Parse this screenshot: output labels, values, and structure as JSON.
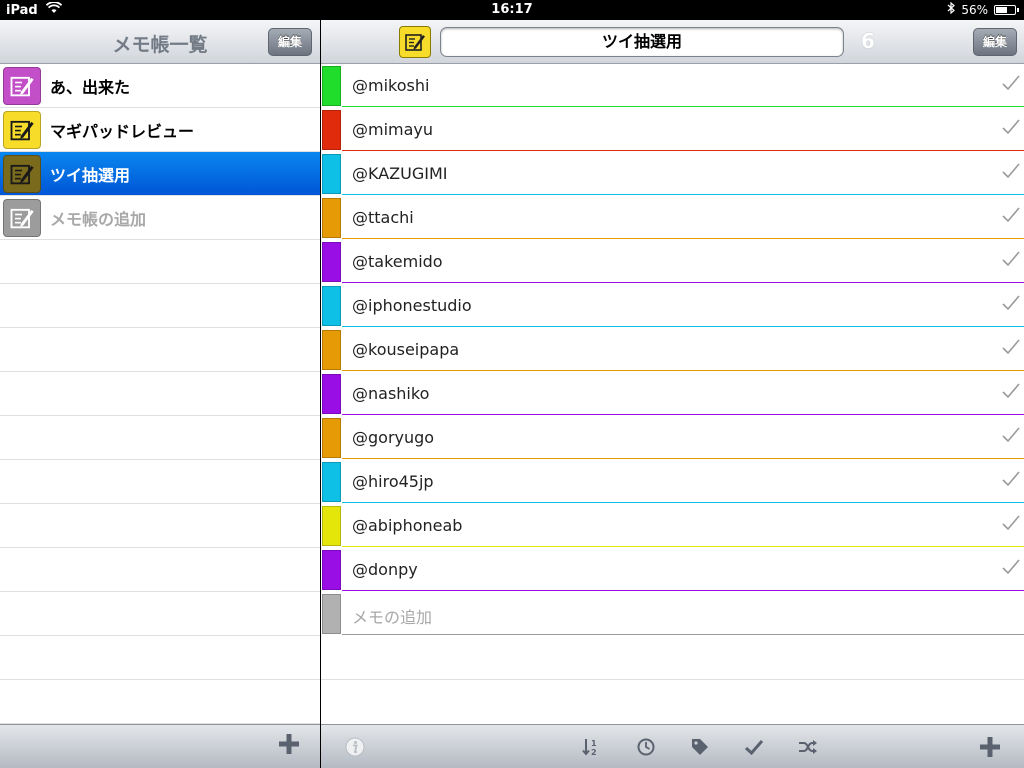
{
  "status": {
    "device": "iPad",
    "time": "16:17",
    "battery_text": "56%",
    "battery_level": 0.56
  },
  "left_pane": {
    "title": "メモ帳一覧",
    "edit_label": "編集",
    "notebooks": [
      {
        "label": "あ、出来た",
        "icon_color": "#c24fc8",
        "selected": false
      },
      {
        "label": "マギパッドレビュー",
        "icon_color": "#f7dd2a",
        "selected": false
      },
      {
        "label": "ツイ抽選用",
        "icon_color": "#7a6a1c",
        "selected": true
      },
      {
        "label": "メモ帳の追加",
        "icon_color": "#9c9c9c",
        "selected": false,
        "add": true
      }
    ],
    "add_icon": "plus-icon"
  },
  "right_pane": {
    "title_field": "ツイ抽選用",
    "count": "6",
    "edit_label": "編集",
    "items": [
      {
        "label": "@mikoshi",
        "color": "#1fdd2a",
        "checked": true
      },
      {
        "label": "@mimayu",
        "color": "#e02c0c",
        "checked": true
      },
      {
        "label": "@KAZUGIMI",
        "color": "#0fc0e6",
        "checked": true
      },
      {
        "label": "@ttachi",
        "color": "#e59a06",
        "checked": true
      },
      {
        "label": "@takemido",
        "color": "#9a0ee6",
        "checked": true
      },
      {
        "label": "@iphonestudio",
        "color": "#0fc0e6",
        "checked": true
      },
      {
        "label": "@kouseipapa",
        "color": "#e59a06",
        "checked": true
      },
      {
        "label": "@nashiko",
        "color": "#9a0ee6",
        "checked": true
      },
      {
        "label": "@goryugo",
        "color": "#e59a06",
        "checked": true
      },
      {
        "label": "@hiro45jp",
        "color": "#0fc0e6",
        "checked": true
      },
      {
        "label": "@abiphoneab",
        "color": "#e4e60a",
        "checked": true
      },
      {
        "label": "@donpy",
        "color": "#9a0ee6",
        "checked": true
      }
    ],
    "add_item_label": "メモの追加",
    "add_item_color": "#b1b1b1"
  },
  "toolbar": {
    "icons": [
      "info-icon",
      "sort-icon",
      "clock-icon",
      "tag-icon",
      "check-icon",
      "shuffle-icon",
      "plus-icon"
    ]
  }
}
